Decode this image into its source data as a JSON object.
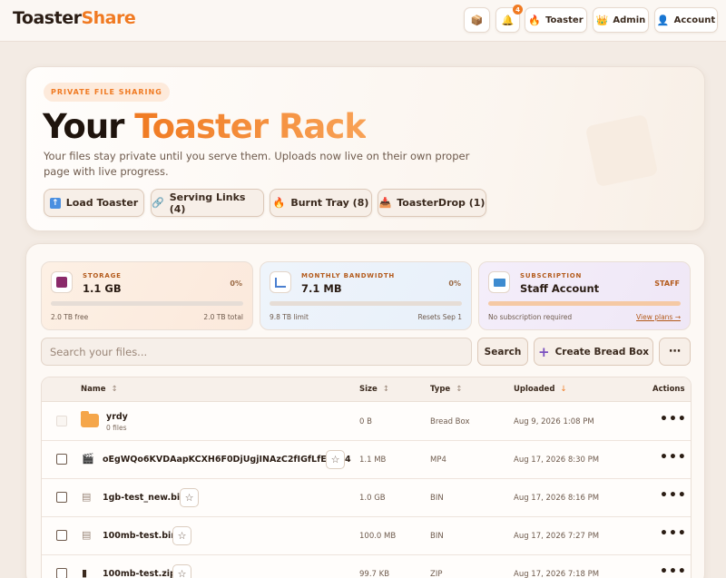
{
  "topbar": {
    "logo_main": "Toaster",
    "logo_accent": "Share",
    "notification_count": "4",
    "buttons": {
      "toaster": "Toaster",
      "admin": "Admin",
      "account": "Account"
    }
  },
  "hero": {
    "pill": "PRIVATE FILE SHARING",
    "title_main": "Your ",
    "title_accent": "Toaster Rack",
    "subtitle": "Your files stay private until you serve them. Uploads now live on their own proper page with live progress.",
    "actions": {
      "load": "Load Toaster",
      "links": "Serving Links (4)",
      "burnt": "Burnt Tray (8)",
      "drop": "ToasterDrop (1)"
    }
  },
  "stats": {
    "storage": {
      "label": "STORAGE",
      "value": "1.1 GB",
      "percent": "0%",
      "fill": 0,
      "left": "2.0 TB free",
      "right": "2.0 TB total"
    },
    "bandwidth": {
      "label": "MONTHLY BANDWIDTH",
      "value": "7.1 MB",
      "percent": "0%",
      "fill": 0,
      "left": "9.8 TB limit",
      "right": "Resets Sep 1"
    },
    "subscription": {
      "label": "SUBSCRIPTION",
      "value": "Staff Account",
      "tag": "STAFF",
      "fill": 1,
      "left": "No subscription required",
      "link": "View plans →"
    }
  },
  "toolbar": {
    "search_placeholder": "Search your files...",
    "search_button": "Search",
    "create_button": "Create Bread Box",
    "more": "⋯"
  },
  "table": {
    "headers": {
      "name": "Name",
      "size": "Size",
      "type": "Type",
      "uploaded": "Uploaded",
      "actions": "Actions"
    },
    "rows": [
      {
        "name": "yrdy",
        "sub": "0 files",
        "size": "0 B",
        "type": "Bread Box",
        "uploaded": "Aug 9, 2026 1:08 PM",
        "icon": "folder-icon"
      },
      {
        "name": "oEgWQo6KVDAapKCXH6F0DjUgjINAzC2fIGfLfE.mp4",
        "size": "1.1 MB",
        "type": "MP4",
        "uploaded": "Aug 17, 2026 8:30 PM",
        "icon": "video-file-icon"
      },
      {
        "name": "1gb-test_new.bin",
        "size": "1.0 GB",
        "type": "BIN",
        "uploaded": "Aug 17, 2026 8:16 PM",
        "icon": "file-icon"
      },
      {
        "name": "100mb-test.bin",
        "size": "100.0 MB",
        "type": "BIN",
        "uploaded": "Aug 17, 2026 7:27 PM",
        "icon": "file-icon"
      },
      {
        "name": "100mb-test.zip",
        "size": "99.7 KB",
        "type": "ZIP",
        "uploaded": "Aug 17, 2026 7:18 PM",
        "icon": "zip-file-icon"
      }
    ]
  },
  "colors": {
    "accent": "#f07a22",
    "background": "#f3ebe4"
  }
}
